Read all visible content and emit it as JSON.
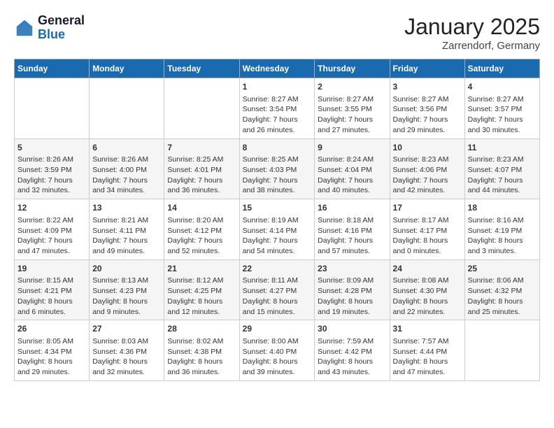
{
  "header": {
    "logo_general": "General",
    "logo_blue": "Blue",
    "month": "January 2025",
    "location": "Zarrendorf, Germany"
  },
  "weekdays": [
    "Sunday",
    "Monday",
    "Tuesday",
    "Wednesday",
    "Thursday",
    "Friday",
    "Saturday"
  ],
  "weeks": [
    [
      {
        "day": "",
        "info": ""
      },
      {
        "day": "",
        "info": ""
      },
      {
        "day": "",
        "info": ""
      },
      {
        "day": "1",
        "info": "Sunrise: 8:27 AM\nSunset: 3:54 PM\nDaylight: 7 hours and 26 minutes."
      },
      {
        "day": "2",
        "info": "Sunrise: 8:27 AM\nSunset: 3:55 PM\nDaylight: 7 hours and 27 minutes."
      },
      {
        "day": "3",
        "info": "Sunrise: 8:27 AM\nSunset: 3:56 PM\nDaylight: 7 hours and 29 minutes."
      },
      {
        "day": "4",
        "info": "Sunrise: 8:27 AM\nSunset: 3:57 PM\nDaylight: 7 hours and 30 minutes."
      }
    ],
    [
      {
        "day": "5",
        "info": "Sunrise: 8:26 AM\nSunset: 3:59 PM\nDaylight: 7 hours and 32 minutes."
      },
      {
        "day": "6",
        "info": "Sunrise: 8:26 AM\nSunset: 4:00 PM\nDaylight: 7 hours and 34 minutes."
      },
      {
        "day": "7",
        "info": "Sunrise: 8:25 AM\nSunset: 4:01 PM\nDaylight: 7 hours and 36 minutes."
      },
      {
        "day": "8",
        "info": "Sunrise: 8:25 AM\nSunset: 4:03 PM\nDaylight: 7 hours and 38 minutes."
      },
      {
        "day": "9",
        "info": "Sunrise: 8:24 AM\nSunset: 4:04 PM\nDaylight: 7 hours and 40 minutes."
      },
      {
        "day": "10",
        "info": "Sunrise: 8:23 AM\nSunset: 4:06 PM\nDaylight: 7 hours and 42 minutes."
      },
      {
        "day": "11",
        "info": "Sunrise: 8:23 AM\nSunset: 4:07 PM\nDaylight: 7 hours and 44 minutes."
      }
    ],
    [
      {
        "day": "12",
        "info": "Sunrise: 8:22 AM\nSunset: 4:09 PM\nDaylight: 7 hours and 47 minutes."
      },
      {
        "day": "13",
        "info": "Sunrise: 8:21 AM\nSunset: 4:11 PM\nDaylight: 7 hours and 49 minutes."
      },
      {
        "day": "14",
        "info": "Sunrise: 8:20 AM\nSunset: 4:12 PM\nDaylight: 7 hours and 52 minutes."
      },
      {
        "day": "15",
        "info": "Sunrise: 8:19 AM\nSunset: 4:14 PM\nDaylight: 7 hours and 54 minutes."
      },
      {
        "day": "16",
        "info": "Sunrise: 8:18 AM\nSunset: 4:16 PM\nDaylight: 7 hours and 57 minutes."
      },
      {
        "day": "17",
        "info": "Sunrise: 8:17 AM\nSunset: 4:17 PM\nDaylight: 8 hours and 0 minutes."
      },
      {
        "day": "18",
        "info": "Sunrise: 8:16 AM\nSunset: 4:19 PM\nDaylight: 8 hours and 3 minutes."
      }
    ],
    [
      {
        "day": "19",
        "info": "Sunrise: 8:15 AM\nSunset: 4:21 PM\nDaylight: 8 hours and 6 minutes."
      },
      {
        "day": "20",
        "info": "Sunrise: 8:13 AM\nSunset: 4:23 PM\nDaylight: 8 hours and 9 minutes."
      },
      {
        "day": "21",
        "info": "Sunrise: 8:12 AM\nSunset: 4:25 PM\nDaylight: 8 hours and 12 minutes."
      },
      {
        "day": "22",
        "info": "Sunrise: 8:11 AM\nSunset: 4:27 PM\nDaylight: 8 hours and 15 minutes."
      },
      {
        "day": "23",
        "info": "Sunrise: 8:09 AM\nSunset: 4:28 PM\nDaylight: 8 hours and 19 minutes."
      },
      {
        "day": "24",
        "info": "Sunrise: 8:08 AM\nSunset: 4:30 PM\nDaylight: 8 hours and 22 minutes."
      },
      {
        "day": "25",
        "info": "Sunrise: 8:06 AM\nSunset: 4:32 PM\nDaylight: 8 hours and 25 minutes."
      }
    ],
    [
      {
        "day": "26",
        "info": "Sunrise: 8:05 AM\nSunset: 4:34 PM\nDaylight: 8 hours and 29 minutes."
      },
      {
        "day": "27",
        "info": "Sunrise: 8:03 AM\nSunset: 4:36 PM\nDaylight: 8 hours and 32 minutes."
      },
      {
        "day": "28",
        "info": "Sunrise: 8:02 AM\nSunset: 4:38 PM\nDaylight: 8 hours and 36 minutes."
      },
      {
        "day": "29",
        "info": "Sunrise: 8:00 AM\nSunset: 4:40 PM\nDaylight: 8 hours and 39 minutes."
      },
      {
        "day": "30",
        "info": "Sunrise: 7:59 AM\nSunset: 4:42 PM\nDaylight: 8 hours and 43 minutes."
      },
      {
        "day": "31",
        "info": "Sunrise: 7:57 AM\nSunset: 4:44 PM\nDaylight: 8 hours and 47 minutes."
      },
      {
        "day": "",
        "info": ""
      }
    ]
  ]
}
